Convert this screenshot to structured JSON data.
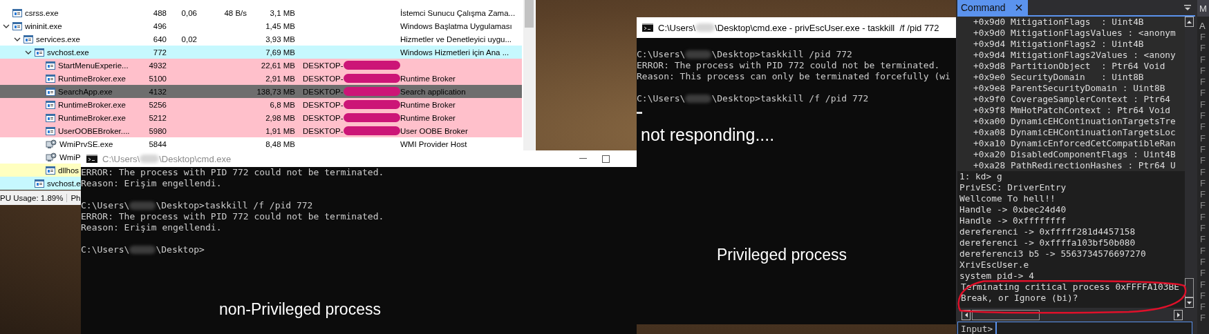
{
  "process_explorer": {
    "rows": [
      {
        "name": "csrss.exe",
        "pid": "488",
        "cpu": "0,06",
        "io": "48 B/s",
        "private_bytes": "3,1 MB",
        "description": "İstemci Sunucu Çalışma Zama...",
        "kind": "window",
        "selected": false
      },
      {
        "name": "wininit.exe",
        "pid": "496",
        "private_bytes": "1,45 MB",
        "description": "Windows Başlatma Uygulaması",
        "kind": "window",
        "selected": false,
        "expanded": true,
        "children": [
          {
            "name": "services.exe",
            "pid": "640",
            "cpu": "0,02",
            "private_bytes": "3,93 MB",
            "description": "Hizmetler ve Denetleyici uygu...",
            "kind": "window",
            "selected": false,
            "expanded": true,
            "children": [
              {
                "name": "svchost.exe",
                "pid": "772",
                "private_bytes": "7,69 MB",
                "description": "Windows Hizmetleri için Ana ...",
                "kind": "window",
                "selected": false,
                "color": "#c6f8fe",
                "expanded": true,
                "children": [
                  {
                    "name": "StartMenuExperie...",
                    "pid": "4932",
                    "private_bytes": "22,61 MB",
                    "user": "DESKTOP-",
                    "kind": "window",
                    "selected": false,
                    "color": "#ffc0cb"
                  },
                  {
                    "name": "RuntimeBroker.exe",
                    "pid": "5100",
                    "private_bytes": "2,91 MB",
                    "user": "DESKTOP-",
                    "description": "Runtime Broker",
                    "kind": "window",
                    "selected": false,
                    "color": "#ffc0cb"
                  },
                  {
                    "name": "SearchApp.exe",
                    "pid": "4132",
                    "private_bytes": "138,73 MB",
                    "user": "DESKTOP-",
                    "description": "Search application",
                    "kind": "window",
                    "selected": true
                  },
                  {
                    "name": "RuntimeBroker.exe",
                    "pid": "5256",
                    "private_bytes": "6,8 MB",
                    "user": "DESKTOP-",
                    "description": "Runtime Broker",
                    "kind": "window",
                    "selected": false,
                    "color": "#ffc0cb"
                  },
                  {
                    "name": "RuntimeBroker.exe",
                    "pid": "5212",
                    "private_bytes": "2,98 MB",
                    "user": "DESKTOP-",
                    "description": "Runtime Broker",
                    "kind": "window",
                    "selected": false,
                    "color": "#ffc0cb"
                  },
                  {
                    "name": "UserOOBEBroker....",
                    "pid": "5980",
                    "private_bytes": "1,91 MB",
                    "user": "DESKTOP-",
                    "description": "User OOBE Broker",
                    "kind": "window",
                    "selected": false,
                    "color": "#ffc0cb"
                  },
                  {
                    "name": "WmiPrvSE.exe",
                    "pid": "5844",
                    "private_bytes": "8,48 MB",
                    "description": "WMI Provider Host",
                    "kind": "service",
                    "selected": false
                  },
                  {
                    "name": "WmiP",
                    "kind": "service",
                    "selected": false
                  },
                  {
                    "name": "dllhos",
                    "kind": "window",
                    "selected": false,
                    "color": "#ffffc0"
                  }
                ]
              },
              {
                "name": "svchost.e",
                "kind": "window",
                "selected": false,
                "color": "#c6f8fe"
              }
            ]
          }
        ]
      }
    ],
    "status_bar": [
      "PU Usage: 1.89%",
      "Ph"
    ]
  },
  "left_console": {
    "title_parts": [
      "C:\\Users\\",
      "\\Desktop\\cmd.exe"
    ],
    "lines": [
      {
        "kind": "text",
        "parts": [
          "ERROR: The process with PID 772 could not be terminated."
        ]
      },
      {
        "kind": "text",
        "parts": [
          "Reason: Erişim engellendi."
        ]
      },
      {
        "kind": "blank"
      },
      {
        "kind": "text",
        "parts": [
          "C:\\Users\\",
          "\\Desktop>taskkill /f /pid 772"
        ]
      },
      {
        "kind": "text",
        "parts": [
          "ERROR: The process with PID 772 could not be terminated."
        ]
      },
      {
        "kind": "text",
        "parts": [
          "Reason: Erişim engellendi."
        ]
      },
      {
        "kind": "blank"
      },
      {
        "kind": "text",
        "parts": [
          "C:\\Users\\",
          "\\Desktop>"
        ]
      }
    ],
    "caption": "non-Privileged process"
  },
  "right_console": {
    "title_parts": [
      "C:\\Users\\",
      "\\Desktop\\cmd.exe - privEscUser.exe - taskkill  /f /pid 772"
    ],
    "lines": [
      {
        "kind": "blank"
      },
      {
        "kind": "text",
        "parts": [
          "C:\\Users\\",
          "\\Desktop>taskkill /pid 772"
        ]
      },
      {
        "kind": "text",
        "parts": [
          "ERROR: The process with PID 772 could not be terminated."
        ]
      },
      {
        "kind": "text",
        "parts": [
          "Reason: This process can only be terminated forcefully (wi"
        ]
      },
      {
        "kind": "blank"
      },
      {
        "kind": "text",
        "parts": [
          "C:\\Users\\",
          "\\Desktop>taskkill /f /pid 772"
        ]
      },
      {
        "kind": "cursor"
      }
    ],
    "note": "not responding....",
    "caption": "Privileged process"
  },
  "debugger": {
    "tab": "Command",
    "struct_lines": [
      "+0x9d0 MitigationFlags  : Uint4B",
      "+0x9d0 MitigationFlagsValues : <anonym",
      "+0x9d4 MitigationFlags2 : Uint4B",
      "+0x9d4 MitigationFlags2Values : <anony",
      "+0x9d8 PartitionObject  : Ptr64 Void",
      "+0x9e0 SecurityDomain   : Uint8B",
      "+0x9e8 ParentSecurityDomain : Uint8B",
      "+0x9f0 CoverageSamplerContext : Ptr64",
      "+0x9f8 MmHotPatchContext : Ptr64 Void",
      "+0xa00 DynamicEHContinuationTargetsTre",
      "+0xa08 DynamicEHContinuationTargetsLoc",
      "+0xa10 DynamicEnforcedCetCompatibleRan",
      "+0xa20 DisabledComponentFlags : Uint4B",
      "+0xa28 PathRedirectionHashes : Ptr64 U"
    ],
    "output_lines": [
      "1: kd> g",
      "PrivESC: DriverEntry",
      "Wellcome To hell!!",
      "Handle -> 0xbec24d40",
      "Handle -> 0xffffffff",
      "dereferenci -> 0xfffff281d4457158",
      "dereferenci -> 0xffffa103bf50b080",
      "dereferenci3 b5 -> 5563734576697270",
      "XrivEscUser.e",
      "system pid-> 4",
      "Terminating critical process 0xFFFFA103BE",
      "Break, or Ignore (bi)?"
    ],
    "input_label": "Input>",
    "side_panel": {
      "tab": "M",
      "header": "A",
      "rows": [
        "F",
        "F",
        "F",
        "F",
        "F",
        "F",
        "F",
        "F",
        "F",
        "F",
        "F",
        "F",
        "F",
        "F",
        "F",
        "F",
        "F",
        "F",
        "F",
        "F",
        "F",
        "F",
        "F",
        "F",
        "F",
        "F"
      ]
    }
  }
}
